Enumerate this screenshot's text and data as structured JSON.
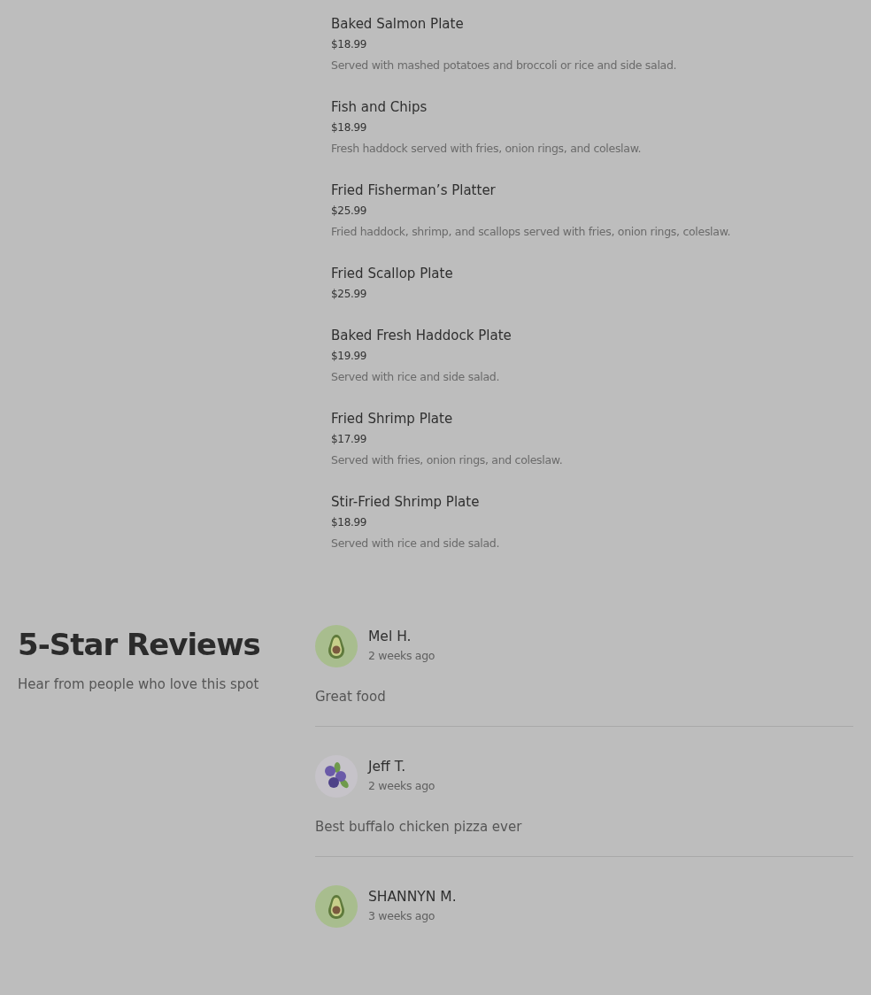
{
  "menu_items": [
    {
      "name": "Baked Salmon Plate",
      "price": "$18.99",
      "description": "Served with mashed potatoes and broccoli or rice and side salad."
    },
    {
      "name": "Fish and Chips",
      "price": "$18.99",
      "description": "Fresh haddock served with fries, onion rings, and coleslaw."
    },
    {
      "name": "Fried Fisherman’s Platter",
      "price": "$25.99",
      "description": "Fried haddock, shrimp, and scallops served with fries, onion rings, coleslaw."
    },
    {
      "name": "Fried Scallop Plate",
      "price": "$25.99"
    },
    {
      "name": "Baked Fresh Haddock Plate",
      "price": "$19.99",
      "description": "Served with rice and side salad."
    },
    {
      "name": "Fried Shrimp Plate",
      "price": "$17.99",
      "description": "Served with fries, onion rings, and coleslaw."
    },
    {
      "name": "Stir-Fried Shrimp Plate",
      "price": "$18.99",
      "description": "Served with rice and side salad."
    }
  ],
  "reviews_section": {
    "title": "5-Star Reviews",
    "subtitle": "Hear from people who love this spot",
    "reviews": [
      {
        "kind": "avocado",
        "name": "Mel H.",
        "time": "2 weeks ago",
        "text": "Great food"
      },
      {
        "kind": "blueberry",
        "name": "Jeff T.",
        "time": "2 weeks ago",
        "text": "Best buffalo chicken pizza ever"
      },
      {
        "kind": "avocado",
        "name": "SHANNYN M.",
        "time": "3 weeks ago"
      }
    ]
  }
}
